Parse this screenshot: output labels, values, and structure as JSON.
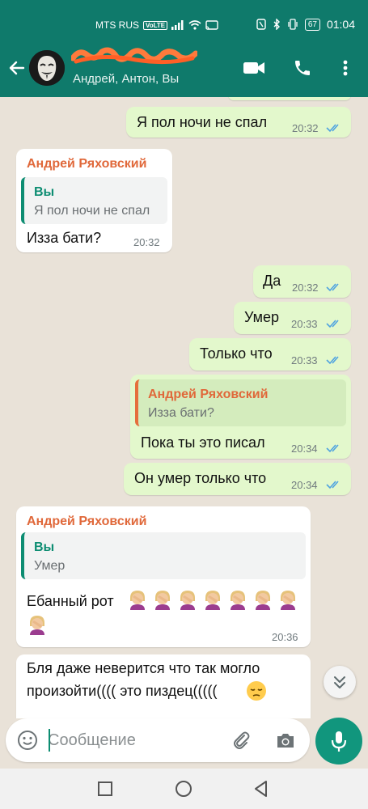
{
  "status_bar": {
    "carrier": "MTS RUS",
    "volte": "VoLTE",
    "battery": "67",
    "time": "01:04"
  },
  "header": {
    "participants": "Андрей, Антон, Вы"
  },
  "messages": [
    {
      "dir": "out",
      "text": "Я пол ночи не спал",
      "time": "20:32"
    },
    {
      "dir": "in",
      "sender": "Андрей Ряховский",
      "quote_name": "Вы",
      "quote_text": "Я пол ночи не спал",
      "text": "Изза бати?",
      "time": "20:32"
    },
    {
      "dir": "out",
      "text": "Да",
      "time": "20:32"
    },
    {
      "dir": "out",
      "text": "Умер",
      "time": "20:33"
    },
    {
      "dir": "out",
      "text": "Только что",
      "time": "20:33"
    },
    {
      "dir": "out",
      "quote_name": "Андрей Ряховский",
      "quote_text": "Изза бати?",
      "text": "Пока ты это писал",
      "time": "20:34"
    },
    {
      "dir": "out",
      "text": "Он умер только что",
      "time": "20:34"
    },
    {
      "dir": "in",
      "sender": "Андрей Ряховский",
      "quote_name": "Вы",
      "quote_text": "Умер",
      "text": "Ебанный рот",
      "emoji": "facepalm-woman x8",
      "time": "20:36"
    },
    {
      "dir": "in",
      "line1": "Бля даже неверится что так могло",
      "line2": "произойти(((( это пиздец(((((",
      "emoji": "pensive-face"
    }
  ],
  "input": {
    "placeholder": "Сообщение"
  },
  "colors": {
    "header": "#0f7a6b",
    "outgoing_bubble": "#e3f8cc",
    "incoming_bubble": "#ffffff",
    "sender_name": "#e0683a",
    "read_ticks": "#4fa3e0",
    "mic_button": "#11967d"
  },
  "icons": [
    "back-arrow-icon",
    "video-call-icon",
    "phone-icon",
    "more-vert-icon",
    "double-check-icon",
    "chevrons-down-icon",
    "emoji-icon",
    "attach-icon",
    "camera-icon",
    "mic-icon",
    "nav-square-icon",
    "nav-circle-icon",
    "nav-triangle-icon"
  ]
}
